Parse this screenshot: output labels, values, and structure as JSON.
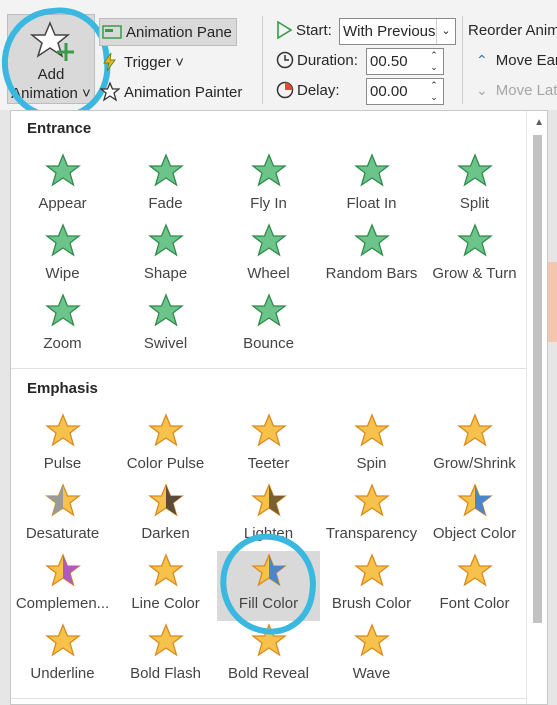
{
  "ribbon": {
    "add_animation": {
      "line1": "Add",
      "line2": "Animation ˅"
    },
    "animation_pane": "Animation Pane",
    "trigger": "Trigger ˅",
    "animation_painter": "Animation Painter",
    "start_label": "Start:",
    "start_value": "With Previous",
    "duration_label": "Duration:",
    "duration_value": "00.50",
    "delay_label": "Delay:",
    "delay_value": "00.00",
    "reorder_label": "Reorder Anim",
    "move_earlier": "Move Ear",
    "move_later": "Move Lat"
  },
  "gallery": {
    "entrance_title": "Entrance",
    "emphasis_title": "Emphasis",
    "entrance": [
      {
        "label": "Appear",
        "icon": "appear-star"
      },
      {
        "label": "Fade",
        "icon": "fade-star"
      },
      {
        "label": "Fly In",
        "icon": "fly-in-star"
      },
      {
        "label": "Float In",
        "icon": "float-in-star"
      },
      {
        "label": "Split",
        "icon": "split-star"
      },
      {
        "label": "Wipe",
        "icon": "wipe-star"
      },
      {
        "label": "Shape",
        "icon": "shape-star"
      },
      {
        "label": "Wheel",
        "icon": "wheel-star"
      },
      {
        "label": "Random Bars",
        "icon": "random-bars-star"
      },
      {
        "label": "Grow & Turn",
        "icon": "grow-turn-star"
      },
      {
        "label": "Zoom",
        "icon": "zoom-star"
      },
      {
        "label": "Swivel",
        "icon": "swivel-star"
      },
      {
        "label": "Bounce",
        "icon": "bounce-star"
      }
    ],
    "emphasis": [
      {
        "label": "Pulse",
        "icon": "pulse-star"
      },
      {
        "label": "Color Pulse",
        "icon": "color-pulse-star"
      },
      {
        "label": "Teeter",
        "icon": "teeter-star"
      },
      {
        "label": "Spin",
        "icon": "spin-star"
      },
      {
        "label": "Grow/Shrink",
        "icon": "grow-shrink-star"
      },
      {
        "label": "Desaturate",
        "icon": "desaturate-star"
      },
      {
        "label": "Darken",
        "icon": "darken-star"
      },
      {
        "label": "Lighten",
        "icon": "lighten-star"
      },
      {
        "label": "Transparency",
        "icon": "transparency-star"
      },
      {
        "label": "Object Color",
        "icon": "object-color-star"
      },
      {
        "label": "Complemen...",
        "icon": "complementary-star"
      },
      {
        "label": "Line Color",
        "icon": "line-color-star"
      },
      {
        "label": "Fill Color",
        "icon": "fill-color-star",
        "selected": true
      },
      {
        "label": "Brush Color",
        "icon": "brush-color-star"
      },
      {
        "label": "Font Color",
        "icon": "font-color-star"
      },
      {
        "label": "Underline",
        "icon": "underline-star"
      },
      {
        "label": "Bold Flash",
        "icon": "bold-flash-star"
      },
      {
        "label": "Bold Reveal",
        "icon": "bold-reveal-star"
      },
      {
        "label": "Wave",
        "icon": "wave-star"
      }
    ]
  },
  "colors": {
    "entrance_green": "#5fb878",
    "emphasis_gold": "#f5c242",
    "highlight_cyan": "#3ab8e0"
  }
}
